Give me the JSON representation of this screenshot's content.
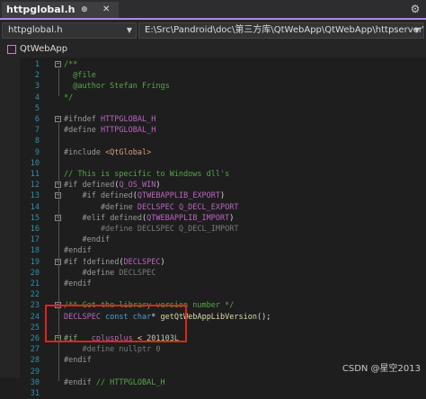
{
  "tab": {
    "title": "httpglobal.h",
    "pin": "⊕",
    "close": "✕"
  },
  "nav": {
    "file_combo": "httpglobal.h",
    "path_combo": "E:\\Src\\Pandroid\\doc\\第三方库\\QtWebApp\\QtWebApp\\httpserver\\httpglobal.h"
  },
  "project": {
    "name": "QtWebApp"
  },
  "watermark": "CSDN @星空2013",
  "colors": {
    "keyword": "#569cd6",
    "preprocessor": "#9b9b9b",
    "macro": "#bd63c5",
    "comment": "#57a64a",
    "type": "#4ec9b0",
    "function": "#dcdcaa",
    "string": "#d69d85",
    "number": "#b5cea8",
    "highlight": "#e0231c"
  },
  "code": [
    {
      "n": "1",
      "fold": "minus",
      "segs": [
        [
          "comment",
          "/**"
        ]
      ]
    },
    {
      "n": "2",
      "segs": [
        [
          "comment",
          "  @file"
        ]
      ]
    },
    {
      "n": "3",
      "segs": [
        [
          "comment",
          "  @author Stefan Frings"
        ]
      ]
    },
    {
      "n": "4",
      "segs": [
        [
          "comment",
          "*/"
        ]
      ]
    },
    {
      "n": "5",
      "segs": []
    },
    {
      "n": "6",
      "fold": "minus",
      "segs": [
        [
          "pp",
          "#ifndef "
        ],
        [
          "macro",
          "HTTPGLOBAL_H"
        ]
      ]
    },
    {
      "n": "7",
      "segs": [
        [
          "pp",
          "#define "
        ],
        [
          "macro",
          "HTTPGLOBAL_H"
        ]
      ]
    },
    {
      "n": "8",
      "segs": []
    },
    {
      "n": "9",
      "segs": [
        [
          "pp",
          "#include "
        ],
        [
          "string",
          "<QtGlobal>"
        ]
      ]
    },
    {
      "n": "10",
      "segs": []
    },
    {
      "n": "11",
      "segs": [
        [
          "comment",
          "// This is specific to Windows dll's"
        ]
      ]
    },
    {
      "n": "12",
      "fold": "minus",
      "segs": [
        [
          "pp",
          "#if "
        ],
        [
          "pp",
          "defined"
        ],
        [
          "plain",
          "("
        ],
        [
          "macro",
          "Q_OS_WIN"
        ],
        [
          "plain",
          ")"
        ]
      ]
    },
    {
      "n": "13",
      "fold": "minus",
      "segs": [
        [
          "pp",
          "    #if "
        ],
        [
          "pp",
          "defined"
        ],
        [
          "plain",
          "("
        ],
        [
          "macro",
          "QTWEBAPPLIB_EXPORT"
        ],
        [
          "plain",
          ")"
        ]
      ]
    },
    {
      "n": "14",
      "segs": [
        [
          "pp",
          "        #define "
        ],
        [
          "macro",
          "DECLSPEC Q_DECL_EXPORT"
        ]
      ]
    },
    {
      "n": "15",
      "fold": "minus",
      "segs": [
        [
          "pp",
          "    #elif "
        ],
        [
          "pp",
          "defined"
        ],
        [
          "plain",
          "("
        ],
        [
          "macro",
          "QTWEBAPPLIB_IMPORT"
        ],
        [
          "plain",
          ")"
        ]
      ]
    },
    {
      "n": "16",
      "segs": [
        [
          "dim",
          "        #define DECLSPEC Q_DECL_IMPORT"
        ]
      ]
    },
    {
      "n": "17",
      "segs": [
        [
          "pp",
          "    #endif"
        ]
      ]
    },
    {
      "n": "18",
      "segs": [
        [
          "pp",
          "#endif"
        ]
      ]
    },
    {
      "n": "19",
      "fold": "minus",
      "segs": [
        [
          "pp",
          "#if "
        ],
        [
          "plain",
          "!"
        ],
        [
          "pp",
          "defined"
        ],
        [
          "plain",
          "("
        ],
        [
          "macro",
          "DECLSPEC"
        ],
        [
          "plain",
          ")"
        ]
      ]
    },
    {
      "n": "20",
      "segs": [
        [
          "pp",
          "    #define "
        ],
        [
          "dim",
          "DECLSPEC"
        ]
      ]
    },
    {
      "n": "21",
      "segs": [
        [
          "pp",
          "#endif"
        ]
      ]
    },
    {
      "n": "22",
      "segs": []
    },
    {
      "n": "23",
      "fold": "minus",
      "segs": [
        [
          "comment",
          "/** Get the library version number */"
        ]
      ]
    },
    {
      "n": "24",
      "segs": [
        [
          "macro",
          "DECLSPEC "
        ],
        [
          "keyword",
          "const "
        ],
        [
          "keyword",
          "char"
        ],
        [
          "plain",
          "* "
        ],
        [
          "function",
          "getQtWebAppLibVersion"
        ],
        [
          "plain",
          "();"
        ]
      ]
    },
    {
      "n": "25",
      "segs": []
    },
    {
      "n": "26",
      "fold": "minus",
      "segs": [
        [
          "pp",
          "#if "
        ],
        [
          "macro",
          "__cplusplus"
        ],
        [
          "plain",
          " < "
        ],
        [
          "number",
          "201103L"
        ]
      ]
    },
    {
      "n": "27",
      "segs": [
        [
          "dim",
          "    #define nullptr 0"
        ]
      ]
    },
    {
      "n": "28",
      "segs": [
        [
          "pp",
          "#endif"
        ]
      ]
    },
    {
      "n": "29",
      "segs": []
    },
    {
      "n": "30",
      "segs": [
        [
          "pp",
          "#endif "
        ],
        [
          "comment",
          "// HTTPGLOBAL_H"
        ]
      ]
    },
    {
      "n": "31",
      "segs": []
    }
  ]
}
